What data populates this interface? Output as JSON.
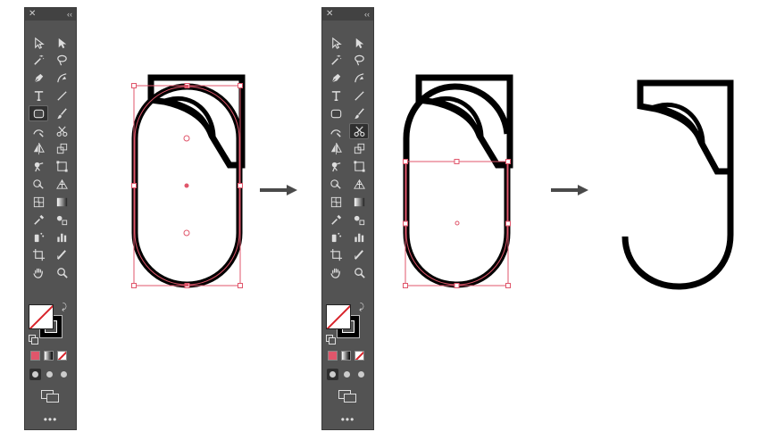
{
  "toolbars": {
    "left": {
      "close_glyph": "✕",
      "collapse_glyph": "‹‹",
      "more_glyph": "•••",
      "active_tool": "rounded-rectangle-tool"
    },
    "right": {
      "close_glyph": "✕",
      "collapse_glyph": "‹‹",
      "more_glyph": "•••",
      "active_tool": "scissors-tool"
    }
  },
  "tools": [
    {
      "name": "selection-tool-icon",
      "col": 0,
      "row": 0
    },
    {
      "name": "direct-selection-tool-icon",
      "col": 1,
      "row": 0
    },
    {
      "name": "magic-wand-tool-icon",
      "col": 0,
      "row": 1
    },
    {
      "name": "lasso-tool-icon",
      "col": 1,
      "row": 1
    },
    {
      "name": "pen-tool-icon",
      "col": 0,
      "row": 2
    },
    {
      "name": "curvature-tool-icon",
      "col": 1,
      "row": 2
    },
    {
      "name": "type-tool-icon",
      "col": 0,
      "row": 3
    },
    {
      "name": "line-segment-tool-icon",
      "col": 1,
      "row": 3
    },
    {
      "name": "rounded-rectangle-tool-icon",
      "col": 0,
      "row": 4
    },
    {
      "name": "paintbrush-tool-icon",
      "col": 1,
      "row": 4
    },
    {
      "name": "shaper-tool-icon",
      "col": 0,
      "row": 5
    },
    {
      "name": "scissors-tool-icon",
      "col": 1,
      "row": 5
    },
    {
      "name": "reflect-tool-icon",
      "col": 0,
      "row": 6
    },
    {
      "name": "scale-tool-icon",
      "col": 1,
      "row": 6
    },
    {
      "name": "puppet-warp-tool-icon",
      "col": 0,
      "row": 7
    },
    {
      "name": "free-transform-tool-icon",
      "col": 1,
      "row": 7
    },
    {
      "name": "shape-builder-tool-icon",
      "col": 0,
      "row": 8
    },
    {
      "name": "perspective-grid-tool-icon",
      "col": 1,
      "row": 8
    },
    {
      "name": "mesh-tool-icon",
      "col": 0,
      "row": 9
    },
    {
      "name": "gradient-tool-icon",
      "col": 1,
      "row": 9
    },
    {
      "name": "eyedropper-tool-icon",
      "col": 0,
      "row": 10
    },
    {
      "name": "blend-tool-icon",
      "col": 1,
      "row": 10
    },
    {
      "name": "symbol-sprayer-tool-icon",
      "col": 0,
      "row": 11
    },
    {
      "name": "column-graph-tool-icon",
      "col": 1,
      "row": 11
    },
    {
      "name": "artboard-tool-icon",
      "col": 0,
      "row": 12
    },
    {
      "name": "slice-tool-icon",
      "col": 1,
      "row": 12
    },
    {
      "name": "hand-tool-icon",
      "col": 0,
      "row": 13
    },
    {
      "name": "zoom-tool-icon",
      "col": 1,
      "row": 13
    }
  ],
  "colors": {
    "toolbar_bg": "#535353",
    "selection_red": "#e0566b",
    "icon": "#dddddd",
    "stroke": "#000000"
  }
}
